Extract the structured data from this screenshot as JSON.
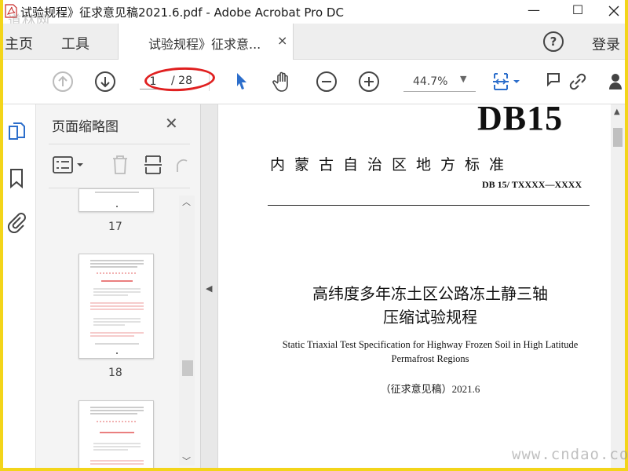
{
  "window": {
    "title": "试验规程》征求意见稿2021.6.pdf - Adobe Acrobat Pro DC",
    "minimize": "—",
    "maximize": "☐",
    "watermark_top_left": "道林网"
  },
  "tabs": {
    "home": "主页",
    "tools": "工具",
    "document_tab": "试验规程》征求意...",
    "close": "×",
    "help": "?",
    "login": "登录"
  },
  "toolbar": {
    "current_page": "1",
    "total_pages": "/ 28",
    "zoom": "44.7%",
    "icons": [
      "up-arrow-icon",
      "down-arrow-icon",
      "select-cursor-icon",
      "hand-icon",
      "zoom-out-icon",
      "zoom-in-icon",
      "fit-page-icon",
      "comment-icon",
      "link-icon",
      "share-user-icon"
    ]
  },
  "thumbnails_panel": {
    "title": "页面缩略图",
    "close": "✕",
    "pages": [
      {
        "number": "17"
      },
      {
        "number": "18"
      }
    ]
  },
  "document": {
    "std_code": "DB15",
    "issuer": "内蒙古自治区地方标准",
    "std_number": "DB 15/ TXXXX—XXXX",
    "title_cn_line1": "高纬度多年冻土区公路冻土静三轴",
    "title_cn_line2": "压缩试验规程",
    "title_en_line1": "Static Triaxial Test Specification for Highway Frozen Soil in High Latitude",
    "title_en_line2": "Permafrost Regions",
    "draft_label": "（征求意见稿）2021.6"
  },
  "watermark_bottom_right": "www.cndao.com",
  "colors": {
    "border": "#f3d51a",
    "accent_blue": "#2c6ecb",
    "annotation_red": "#e02020"
  }
}
